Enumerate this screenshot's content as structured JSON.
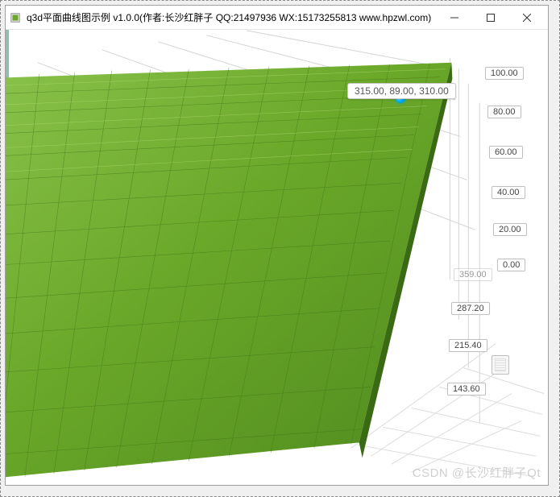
{
  "window": {
    "title": "q3d平面曲线图示例 v1.0.0(作者:长沙红胖子 QQ:21497936 WX:15173255813 www.hpzwl.com)"
  },
  "chart_data": {
    "type": "surface3d",
    "tooltip": "315.00, 89.00, 310.00",
    "selected_point": {
      "x": 315.0,
      "y": 89.0,
      "z": 310.0
    },
    "z_axis_ticks": [
      "100.00",
      "80.00",
      "60.00",
      "40.00",
      "20.00",
      "0.00"
    ],
    "depth_axis_ticks": [
      "359.00",
      "287.20",
      "215.40",
      "143.60"
    ],
    "surface_color": "#6aa82a",
    "grid_color": "#cccccc"
  },
  "watermark": "CSDN @长沙红胖子Qt"
}
